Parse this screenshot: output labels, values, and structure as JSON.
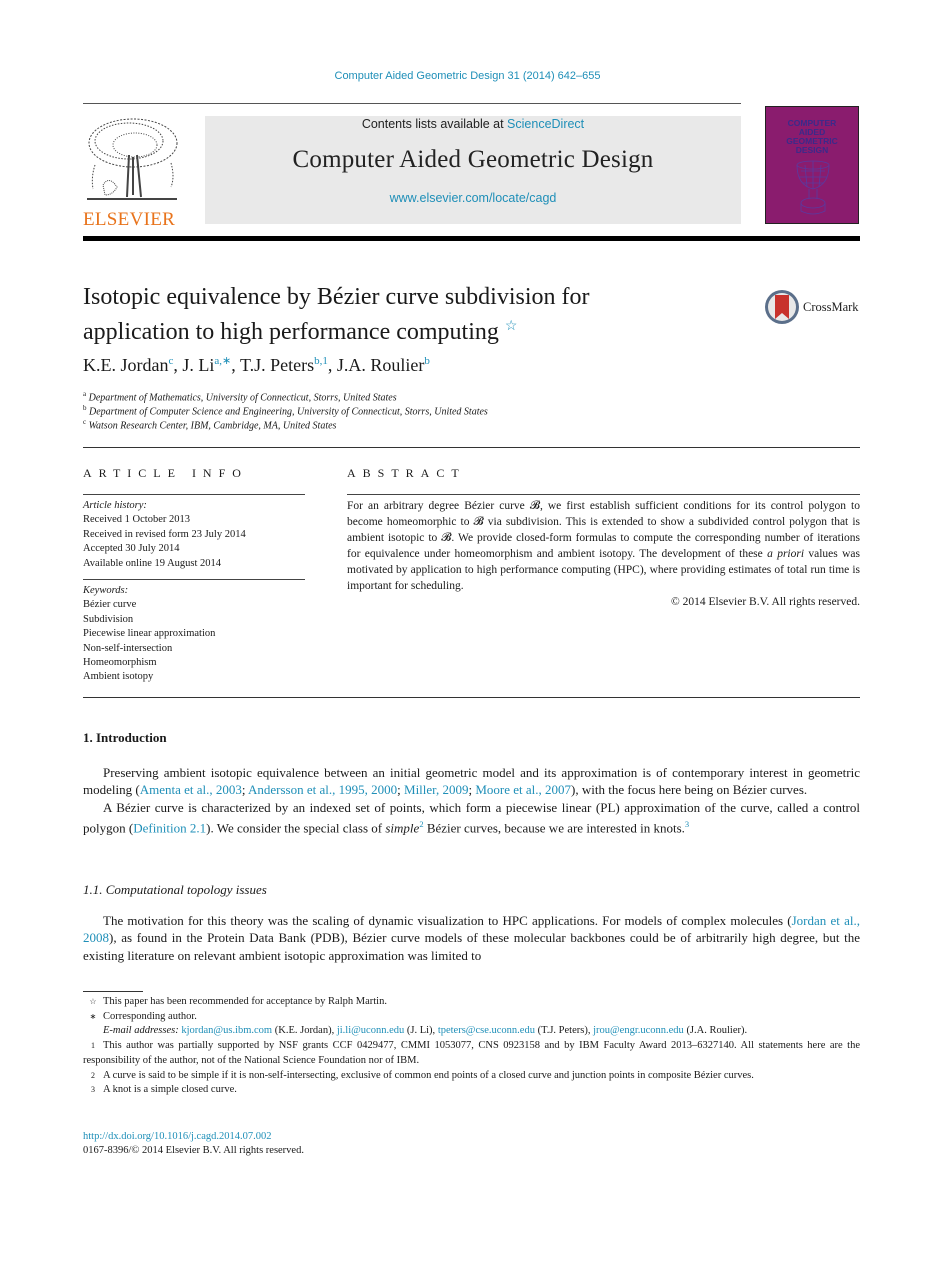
{
  "journal_ref": "Computer Aided Geometric Design 31 (2014) 642–655",
  "header": {
    "publisher_logo_text": "ELSEVIER",
    "contents_prefix": "Contents lists available at ",
    "contents_link": "ScienceDirect",
    "journal_title": "Computer Aided Geometric Design",
    "journal_url": "www.elsevier.com/locate/cagd",
    "cover_title_lines": [
      "COMPUTER",
      "AIDED",
      "GEOMETRIC",
      "DESIGN"
    ]
  },
  "article": {
    "title_line1": "Isotopic equivalence by Bézier curve subdivision for",
    "title_line2": "application to high performance computing",
    "title_mark": "☆",
    "crossmark_label": "CrossMark",
    "authors": [
      {
        "name": "K.E. Jordan",
        "sup": "c",
        "sep": ", "
      },
      {
        "name": "J. Li",
        "sup": "a,∗",
        "sep": ", "
      },
      {
        "name": "T.J. Peters",
        "sup": "b,1",
        "sep": ", "
      },
      {
        "name": "J.A. Roulier",
        "sup": "b",
        "sep": ""
      }
    ],
    "affiliations": [
      {
        "mark": "a",
        "text": "Department of Mathematics, University of Connecticut, Storrs, United States"
      },
      {
        "mark": "b",
        "text": "Department of Computer Science and Engineering, University of Connecticut, Storrs, United States"
      },
      {
        "mark": "c",
        "text": "Watson Research Center, IBM, Cambridge, MA, United States"
      }
    ]
  },
  "article_info": {
    "heading": "ARTICLE INFO",
    "history_label": "Article history:",
    "history": [
      "Received 1 October 2013",
      "Received in revised form 23 July 2014",
      "Accepted 30 July 2014",
      "Available online 19 August 2014"
    ],
    "keywords_label": "Keywords:",
    "keywords": [
      "Bézier curve",
      "Subdivision",
      "Piecewise linear approximation",
      "Non-self-intersection",
      "Homeomorphism",
      "Ambient isotopy"
    ]
  },
  "abstract": {
    "heading": "ABSTRACT",
    "part1": "For an arbitrary degree Bézier curve 𝓑, we first establish sufficient conditions for its control polygon to become homeomorphic to 𝓑 via subdivision. This is extended to show a subdivided control polygon that is ambient isotopic to 𝓑. We provide closed-form formulas to compute the corresponding number of iterations for equivalence under homeomorphism and ambient isotopy. The development of these ",
    "italic": "a priori",
    "part2": " values was motivated by application to high performance computing (HPC), where providing estimates of total run time is important for scheduling.",
    "copyright": "© 2014 Elsevier B.V. All rights reserved."
  },
  "intro": {
    "heading": "1.  Introduction",
    "p1_a": "Preserving ambient isotopic equivalence between an initial geometric model and its approximation is of contemporary interest in geometric modeling (",
    "p1_refs": [
      {
        "text": "Amenta et al., 2003",
        "sep": "; "
      },
      {
        "text": "Andersson et al., 1995, 2000",
        "sep": "; "
      },
      {
        "text": "Miller, 2009",
        "sep": "; "
      },
      {
        "text": "Moore et al., 2007",
        "sep": ""
      }
    ],
    "p1_b": "), with the focus here being on Bézier curves.",
    "p2_a": "A Bézier curve is characterized by an indexed set of points, which form a piecewise linear (PL) approximation of the curve, called a control polygon (",
    "p2_link": "Definition 2.1",
    "p2_b": "). We consider the special class of ",
    "p2_italic": "simple",
    "p2_sup1": "2",
    "p2_c": " Bézier curves, because we are interested in knots.",
    "p2_sup2": "3",
    "sub_heading": "1.1.  Computational topology issues",
    "p3_a": "The motivation for this theory was the scaling of dynamic visualization to HPC applications. For models of complex molecules (",
    "p3_link": "Jordan et al., 2008",
    "p3_b": "), as found in the Protein Data Bank (PDB), Bézier curve models of these molecular backbones could be of arbitrarily high degree, but the existing literature on relevant ambient isotopic approximation was limited to"
  },
  "footnotes": {
    "star_mark": "☆",
    "star_text": "This paper has been recommended for acceptance by Ralph Martin.",
    "corr_mark": "∗",
    "corr_text": "Corresponding author.",
    "email_label": "E-mail addresses:",
    "emails": [
      {
        "addr": "kjordan@us.ibm.com",
        "who": " (K.E. Jordan), "
      },
      {
        "addr": "ji.li@uconn.edu",
        "who": " (J. Li), "
      },
      {
        "addr": "tpeters@cse.uconn.edu",
        "who": " (T.J. Peters), "
      },
      {
        "addr": "jrou@engr.uconn.edu",
        "who": " (J.A. Roulier)."
      }
    ],
    "fn1_mark": "1",
    "fn1_text": "This author was partially supported by NSF grants CCF 0429477, CMMI 1053077, CNS 0923158 and by IBM Faculty Award 2013–6327140. All statements here are the responsibility of the author, not of the National Science Foundation nor of IBM.",
    "fn2_mark": "2",
    "fn2_text": "A curve is said to be simple if it is non-self-intersecting, exclusive of common end points of a closed curve and junction points in composite Bézier curves.",
    "fn3_mark": "3",
    "fn3_text": "A knot is a simple closed curve."
  },
  "bottom": {
    "doi": "http://dx.doi.org/10.1016/j.cagd.2014.07.002",
    "issn": "0167-8396/© 2014 Elsevier B.V. All rights reserved."
  },
  "colors": {
    "link": "#1f8fb8",
    "elsevier_orange": "#e8731b",
    "cover_purple": "#8a1c6e",
    "banner_gray": "#e9e9e9"
  }
}
